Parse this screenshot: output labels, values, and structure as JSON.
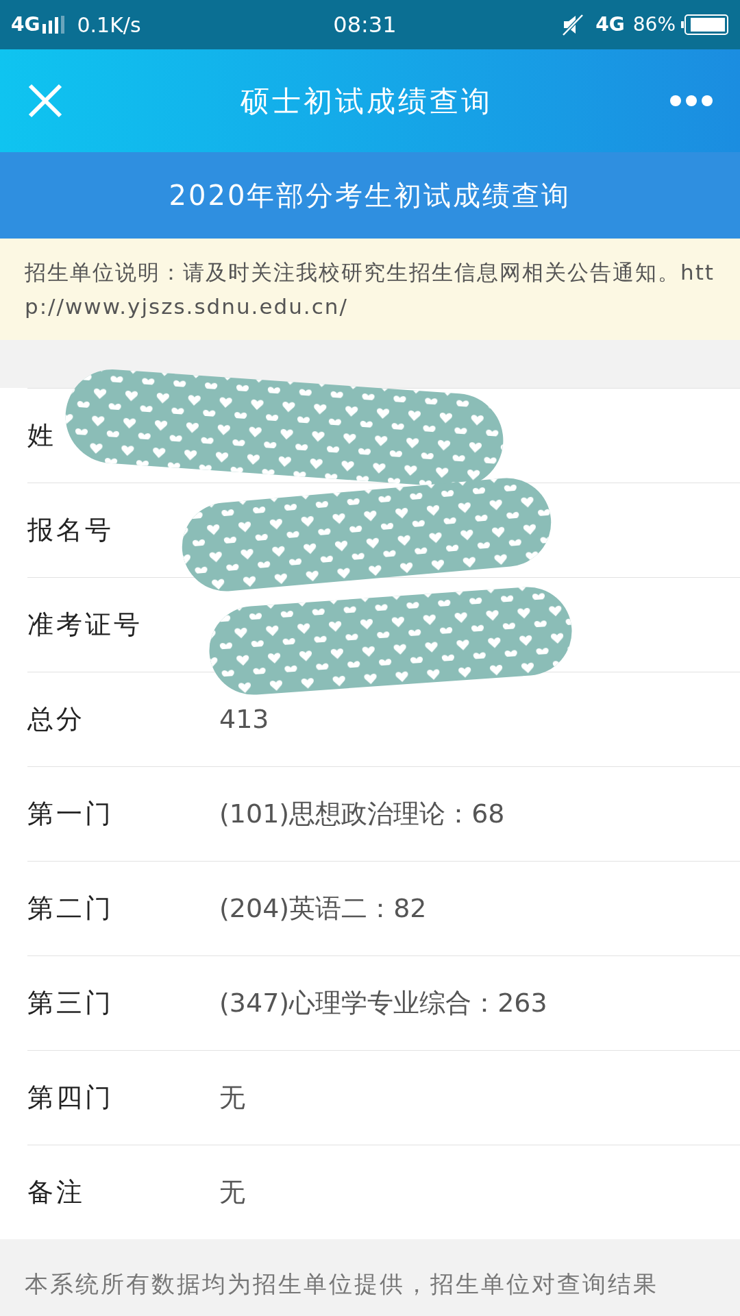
{
  "status_bar": {
    "network": "4G",
    "speed": "0.1K/s",
    "time": "08:31",
    "network_right": "4G",
    "battery": "86%"
  },
  "header": {
    "title": "硕士初试成绩查询"
  },
  "banner": {
    "title": "2020年部分考生初试成绩查询"
  },
  "notice": {
    "text": "招生单位说明：请及时关注我校研究生招生信息网相关公告通知。http://www.yjszs.sdnu.edu.cn/"
  },
  "rows": [
    {
      "label": "姓"
    },
    {
      "label": "报名号"
    },
    {
      "label": "准考证号"
    },
    {
      "label": "总分",
      "value": "413"
    },
    {
      "label": "第一门",
      "value": "(101)思想政治理论：68"
    },
    {
      "label": "第二门",
      "value": "(204)英语二：82"
    },
    {
      "label": "第三门",
      "value": "(347)心理学专业综合：263"
    },
    {
      "label": "第四门",
      "value": "无"
    },
    {
      "label": "备注",
      "value": "无"
    }
  ],
  "footer": {
    "text": "本系统所有数据均为招生单位提供，招生单位对查询结果"
  }
}
